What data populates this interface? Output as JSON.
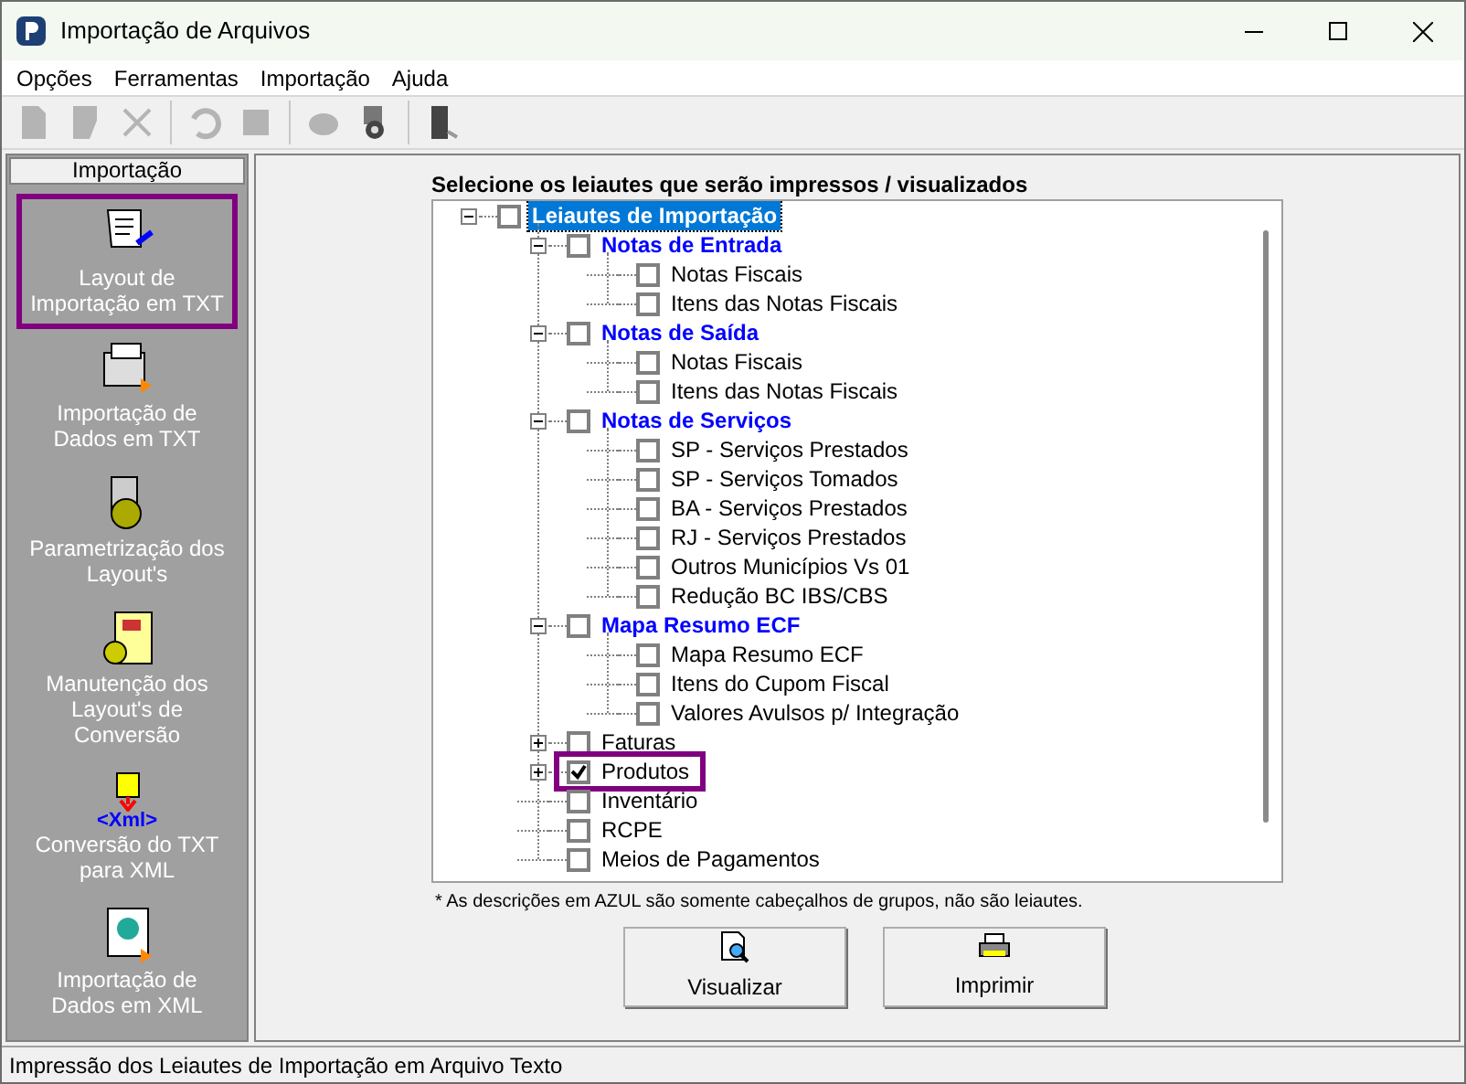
{
  "window": {
    "title": "Importação de Arquivos"
  },
  "menu": [
    "Opções",
    "Ferramentas",
    "Importação",
    "Ajuda"
  ],
  "toolbar": [
    {
      "kind": "new",
      "disabled": true
    },
    {
      "kind": "edit",
      "disabled": true
    },
    {
      "kind": "delete",
      "disabled": true
    },
    {
      "kind": "sep"
    },
    {
      "kind": "undo",
      "disabled": true
    },
    {
      "kind": "stop",
      "disabled": true
    },
    {
      "kind": "sep"
    },
    {
      "kind": "print",
      "disabled": true
    },
    {
      "kind": "config",
      "disabled": false
    },
    {
      "kind": "sep"
    },
    {
      "kind": "exit",
      "disabled": false
    }
  ],
  "sidebar": {
    "title": "Importação",
    "items": [
      {
        "label": "Layout de Importação em TXT",
        "kind": "scroll",
        "selected": true
      },
      {
        "label": "Importação de Dados em TXT",
        "kind": "machine",
        "selected": false
      },
      {
        "label": "Parametrização dos Layout's",
        "kind": "gear",
        "selected": false
      },
      {
        "label": "Manutenção dos Layout's de Conversão",
        "kind": "sheet",
        "selected": false
      },
      {
        "label": "Conversão do TXT para XML",
        "kind": "xml",
        "selected": false,
        "badge": "<Xml>"
      },
      {
        "label": "Importação de Dados em XML",
        "kind": "globe",
        "selected": false
      }
    ]
  },
  "heading": "Selecione os leiautes que serão impressos / visualizados",
  "tree": [
    {
      "label": "Leiautes de Importação",
      "kind": "group",
      "checked": false,
      "selected": true,
      "highlighted": false,
      "expanded": true,
      "children": [
        {
          "label": "Notas de Entrada",
          "kind": "group",
          "checked": false,
          "selected": false,
          "highlighted": false,
          "expanded": true,
          "children": [
            {
              "label": "Notas Fiscais",
              "kind": "leaf",
              "checked": false,
              "selected": false,
              "highlighted": false
            },
            {
              "label": "Itens das Notas Fiscais",
              "kind": "leaf",
              "checked": false,
              "selected": false,
              "highlighted": false
            }
          ]
        },
        {
          "label": "Notas de Saída",
          "kind": "group",
          "checked": false,
          "selected": false,
          "highlighted": false,
          "expanded": true,
          "children": [
            {
              "label": "Notas Fiscais",
              "kind": "leaf",
              "checked": false,
              "selected": false,
              "highlighted": false
            },
            {
              "label": "Itens das Notas Fiscais",
              "kind": "leaf",
              "checked": false,
              "selected": false,
              "highlighted": false
            }
          ]
        },
        {
          "label": "Notas de Serviços",
          "kind": "group",
          "checked": false,
          "selected": false,
          "highlighted": false,
          "expanded": true,
          "children": [
            {
              "label": "SP - Serviços Prestados",
              "kind": "leaf",
              "checked": false,
              "selected": false,
              "highlighted": false
            },
            {
              "label": "SP - Serviços Tomados",
              "kind": "leaf",
              "checked": false,
              "selected": false,
              "highlighted": false
            },
            {
              "label": "BA - Serviços Prestados",
              "kind": "leaf",
              "checked": false,
              "selected": false,
              "highlighted": false
            },
            {
              "label": "RJ - Serviços Prestados",
              "kind": "leaf",
              "checked": false,
              "selected": false,
              "highlighted": false
            },
            {
              "label": "Outros Municípios Vs 01",
              "kind": "leaf",
              "checked": false,
              "selected": false,
              "highlighted": false
            },
            {
              "label": "Redução BC IBS/CBS",
              "kind": "leaf",
              "checked": false,
              "selected": false,
              "highlighted": false
            }
          ]
        },
        {
          "label": "Mapa Resumo ECF",
          "kind": "group",
          "checked": false,
          "selected": false,
          "highlighted": false,
          "expanded": true,
          "children": [
            {
              "label": "Mapa Resumo ECF",
              "kind": "leaf",
              "checked": false,
              "selected": false,
              "highlighted": false
            },
            {
              "label": "Itens do Cupom Fiscal",
              "kind": "leaf",
              "checked": false,
              "selected": false,
              "highlighted": false
            },
            {
              "label": "Valores Avulsos p/ Integração",
              "kind": "leaf",
              "checked": false,
              "selected": false,
              "highlighted": false
            }
          ]
        },
        {
          "label": "Faturas",
          "kind": "leaf",
          "checked": false,
          "selected": false,
          "highlighted": false,
          "expanded": false
        },
        {
          "label": "Produtos",
          "kind": "leaf",
          "checked": true,
          "selected": false,
          "highlighted": true,
          "expanded": false
        },
        {
          "label": "Inventário",
          "kind": "leaf",
          "checked": false,
          "selected": false,
          "highlighted": false
        },
        {
          "label": "RCPE",
          "kind": "leaf",
          "checked": false,
          "selected": false,
          "highlighted": false
        },
        {
          "label": "Meios de Pagamentos",
          "kind": "leaf",
          "checked": false,
          "selected": false,
          "highlighted": false
        }
      ]
    }
  ],
  "footnote": "* As descrições em AZUL são somente cabeçalhos de grupos, não são leiautes.",
  "buttons": [
    {
      "label": "Visualizar",
      "kind": "preview"
    },
    {
      "label": "Imprimir",
      "kind": "print"
    }
  ],
  "status_bar": "Impressão dos Leiautes de Importação em Arquivo Texto"
}
